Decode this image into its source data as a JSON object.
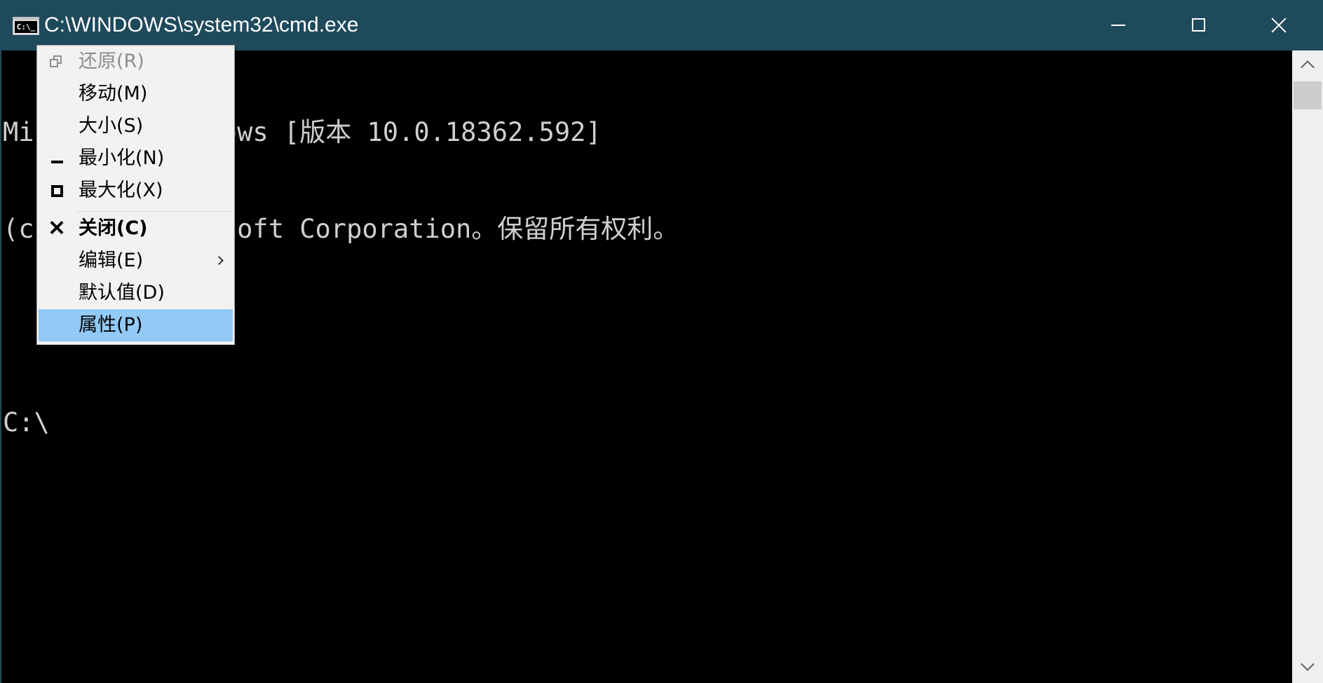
{
  "window": {
    "title": "C:\\WINDOWS\\system32\\cmd.exe",
    "app_icon_text": "C:\\_",
    "minimize_icon": "minimize-icon",
    "maximize_icon": "maximize-icon",
    "close_icon": "close-icon"
  },
  "console": {
    "lines": [
      "Microsoft Windows [版本 10.0.18362.592]",
      "(c) 2019 Microsoft Corporation。保留所有权利。",
      "",
      "C:\\"
    ]
  },
  "system_menu": {
    "items": [
      {
        "label": "还原(R)",
        "state": "disabled",
        "icon": "restore-icon"
      },
      {
        "label": "移动(M)"
      },
      {
        "label": "大小(S)"
      },
      {
        "label": "最小化(N)",
        "icon": "minimize-icon"
      },
      {
        "label": "最大化(X)",
        "icon": "maximize-icon"
      },
      {
        "label": "关闭(C)",
        "style": "bold",
        "icon": "close-icon"
      },
      {
        "label": "编辑(E)",
        "submenu": true,
        "icon": "submenu-arrow-icon"
      },
      {
        "label": "默认值(D)"
      },
      {
        "label": "属性(P)",
        "state": "highlighted"
      }
    ]
  },
  "colors": {
    "titlebar": "#1f4a5c",
    "console_bg": "#000000",
    "console_text": "#cfcfcf",
    "menu_bg": "#f2f2f2",
    "menu_highlight": "#91c9f7"
  }
}
